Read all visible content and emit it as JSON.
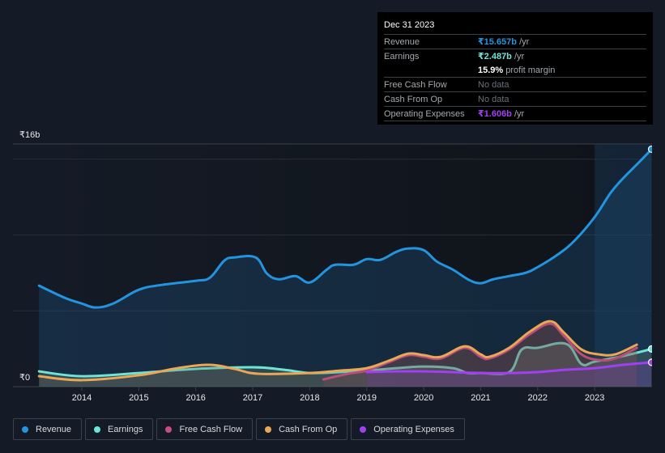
{
  "tooltip": {
    "date": "Dec 31 2023",
    "rows": [
      {
        "label": "Revenue",
        "value": "₹15.657b",
        "unit": " /yr",
        "color": "#2394df"
      },
      {
        "label": "Earnings",
        "value": "₹2.487b",
        "unit": " /yr",
        "color": "#6ce5d5"
      },
      {
        "label": "",
        "value": "15.9%",
        "unit": " profit margin",
        "color": "#ffffff"
      },
      {
        "label": "Free Cash Flow",
        "value": "No data",
        "unit": "",
        "color": ""
      },
      {
        "label": "Cash From Op",
        "value": "No data",
        "unit": "",
        "color": ""
      },
      {
        "label": "Operating Expenses",
        "value": "₹1.606b",
        "unit": " /yr",
        "color": "#a040f0"
      }
    ]
  },
  "legend": [
    {
      "label": "Revenue",
      "color": "#2394df"
    },
    {
      "label": "Earnings",
      "color": "#6ce5d5"
    },
    {
      "label": "Free Cash Flow",
      "color": "#c94a86"
    },
    {
      "label": "Cash From Op",
      "color": "#e8a857"
    },
    {
      "label": "Operating Expenses",
      "color": "#a040f0"
    }
  ],
  "chart_data": {
    "type": "area",
    "title": "",
    "xlabel": "",
    "ylabel": "",
    "y_tick_labels": [
      {
        "value": 16,
        "label": "₹16b"
      },
      {
        "value": 0,
        "label": "₹0"
      }
    ],
    "ylim": [
      0,
      16
    ],
    "y_gridlines": [
      5,
      10,
      15
    ],
    "xlim": [
      2013.25,
      2024.0
    ],
    "x_ticks": [
      2014,
      2015,
      2016,
      2017,
      2018,
      2019,
      2020,
      2021,
      2022,
      2023
    ],
    "units": "₹ billions",
    "highlight_from": 2023.0,
    "grid": true,
    "legend_position": "bottom",
    "series": [
      {
        "name": "Revenue",
        "color": "#2394df",
        "points": [
          [
            2013.25,
            6.66
          ],
          [
            2013.7,
            5.86
          ],
          [
            2014.0,
            5.48
          ],
          [
            2014.24,
            5.22
          ],
          [
            2014.55,
            5.48
          ],
          [
            2015.0,
            6.39
          ],
          [
            2015.4,
            6.71
          ],
          [
            2016.0,
            6.98
          ],
          [
            2016.25,
            7.19
          ],
          [
            2016.5,
            8.31
          ],
          [
            2016.68,
            8.52
          ],
          [
            2017.05,
            8.52
          ],
          [
            2017.25,
            7.45
          ],
          [
            2017.46,
            7.08
          ],
          [
            2017.75,
            7.29
          ],
          [
            2018.0,
            6.87
          ],
          [
            2018.3,
            7.72
          ],
          [
            2018.45,
            8.04
          ],
          [
            2018.77,
            8.04
          ],
          [
            2019.0,
            8.41
          ],
          [
            2019.24,
            8.36
          ],
          [
            2019.52,
            8.89
          ],
          [
            2019.73,
            9.11
          ],
          [
            2020.0,
            9.0
          ],
          [
            2020.23,
            8.25
          ],
          [
            2020.51,
            7.72
          ],
          [
            2020.8,
            7.03
          ],
          [
            2021.0,
            6.82
          ],
          [
            2021.22,
            7.08
          ],
          [
            2021.5,
            7.29
          ],
          [
            2021.79,
            7.51
          ],
          [
            2022.0,
            7.88
          ],
          [
            2022.36,
            8.73
          ],
          [
            2022.65,
            9.64
          ],
          [
            2023.0,
            11.18
          ],
          [
            2023.28,
            12.78
          ],
          [
            2023.5,
            13.74
          ],
          [
            2023.78,
            14.8
          ],
          [
            2024.0,
            15.657
          ]
        ]
      },
      {
        "name": "Earnings",
        "color": "#6ce5d5",
        "points": [
          [
            2013.25,
            1.01
          ],
          [
            2014.0,
            0.69
          ],
          [
            2015.0,
            0.9
          ],
          [
            2016.0,
            1.17
          ],
          [
            2017.0,
            1.28
          ],
          [
            2017.54,
            1.12
          ],
          [
            2018.0,
            0.9
          ],
          [
            2018.53,
            0.96
          ],
          [
            2019.0,
            1.06
          ],
          [
            2019.52,
            1.22
          ],
          [
            2020.0,
            1.33
          ],
          [
            2020.51,
            1.22
          ],
          [
            2020.77,
            0.9
          ],
          [
            2021.0,
            0.9
          ],
          [
            2021.5,
            0.96
          ],
          [
            2021.72,
            2.45
          ],
          [
            2022.0,
            2.56
          ],
          [
            2022.5,
            2.82
          ],
          [
            2022.77,
            1.49
          ],
          [
            2023.0,
            1.65
          ],
          [
            2023.5,
            2.02
          ],
          [
            2024.0,
            2.487
          ]
        ]
      },
      {
        "name": "Free Cash Flow",
        "color": "#c94a86",
        "points": [
          [
            2018.24,
            0.48
          ],
          [
            2018.67,
            0.85
          ],
          [
            2019.0,
            1.06
          ],
          [
            2019.38,
            1.6
          ],
          [
            2019.73,
            2.08
          ],
          [
            2020.0,
            1.97
          ],
          [
            2020.3,
            1.86
          ],
          [
            2020.72,
            2.56
          ],
          [
            2021.0,
            1.97
          ],
          [
            2021.15,
            1.86
          ],
          [
            2021.5,
            2.45
          ],
          [
            2021.86,
            3.46
          ],
          [
            2022.22,
            4.15
          ],
          [
            2022.46,
            3.35
          ],
          [
            2022.77,
            2.13
          ],
          [
            2023.07,
            1.76
          ],
          [
            2023.36,
            1.86
          ],
          [
            2023.74,
            2.56
          ]
        ]
      },
      {
        "name": "Cash From Op",
        "color": "#e8a857",
        "points": [
          [
            2013.25,
            0.69
          ],
          [
            2014.0,
            0.43
          ],
          [
            2015.0,
            0.75
          ],
          [
            2015.68,
            1.22
          ],
          [
            2016.25,
            1.44
          ],
          [
            2016.68,
            1.17
          ],
          [
            2017.1,
            0.85
          ],
          [
            2018.0,
            0.9
          ],
          [
            2018.53,
            1.06
          ],
          [
            2019.0,
            1.22
          ],
          [
            2019.38,
            1.7
          ],
          [
            2019.73,
            2.18
          ],
          [
            2020.0,
            2.08
          ],
          [
            2020.3,
            1.97
          ],
          [
            2020.72,
            2.66
          ],
          [
            2021.0,
            2.13
          ],
          [
            2021.15,
            1.97
          ],
          [
            2021.5,
            2.56
          ],
          [
            2021.86,
            3.62
          ],
          [
            2022.22,
            4.31
          ],
          [
            2022.46,
            3.57
          ],
          [
            2022.77,
            2.45
          ],
          [
            2023.07,
            2.13
          ],
          [
            2023.36,
            2.13
          ],
          [
            2023.74,
            2.77
          ]
        ]
      },
      {
        "name": "Operating Expenses",
        "color": "#a040f0",
        "points": [
          [
            2019.0,
            0.96
          ],
          [
            2019.52,
            1.01
          ],
          [
            2020.0,
            1.01
          ],
          [
            2020.51,
            0.96
          ],
          [
            2021.0,
            0.9
          ],
          [
            2021.5,
            0.9
          ],
          [
            2022.0,
            0.96
          ],
          [
            2022.5,
            1.12
          ],
          [
            2023.0,
            1.22
          ],
          [
            2023.5,
            1.44
          ],
          [
            2024.0,
            1.606
          ]
        ]
      }
    ]
  }
}
